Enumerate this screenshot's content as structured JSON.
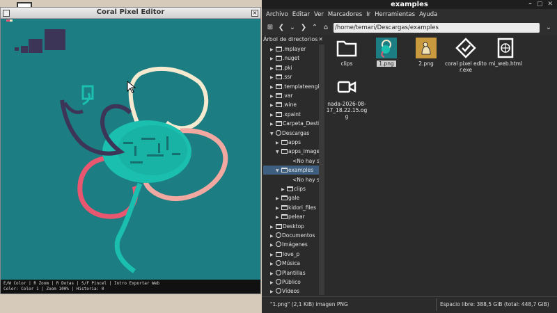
{
  "coral": {
    "title": "Coral Pixel Editor",
    "status_line1": "E/W Color | R Zoom | R Dotas | S/F Pincel | Intro Exportar Web",
    "status_line2": "Color: Color 1 | Zoom 100% | Historia: 0",
    "colors": {
      "background": "#1c7d83",
      "teal": "#1abfb0",
      "dark_purple": "#3d3557",
      "cream": "#f5ead0",
      "pink": "#f0a8a0",
      "red_pink": "#e8576f"
    }
  },
  "fm": {
    "title": "examples",
    "menu": [
      "Archivo",
      "Editar",
      "Ver",
      "Marcadores",
      "Ir",
      "Herramientas",
      "Ayuda"
    ],
    "path": "/home/temari/Descargas/examples",
    "sidebar_title": "Árbol de directorios",
    "tree": [
      {
        "label": ".mplayer",
        "indent": 1,
        "arrow": "▶",
        "icon": "folder"
      },
      {
        "label": ".nuget",
        "indent": 1,
        "arrow": "▶",
        "icon": "folder"
      },
      {
        "label": ".pki",
        "indent": 1,
        "arrow": "▶",
        "icon": "folder"
      },
      {
        "label": ".ssr",
        "indent": 1,
        "arrow": "▶",
        "icon": "folder"
      },
      {
        "label": ".templateengine",
        "indent": 1,
        "arrow": "▶",
        "icon": "folder"
      },
      {
        "label": ".var",
        "indent": 1,
        "arrow": "▶",
        "icon": "folder"
      },
      {
        "label": ".wine",
        "indent": 1,
        "arrow": "▶",
        "icon": "folder"
      },
      {
        "label": ".xpaint",
        "indent": 1,
        "arrow": "▶",
        "icon": "folder"
      },
      {
        "label": "Carpeta_Destino",
        "indent": 1,
        "arrow": "▶",
        "icon": "folder"
      },
      {
        "label": "Descargas",
        "indent": 1,
        "arrow": "▼",
        "icon": "download"
      },
      {
        "label": "apps",
        "indent": 2,
        "arrow": "▶",
        "icon": "folder"
      },
      {
        "label": "apps_imagenes",
        "indent": 2,
        "arrow": "▼",
        "icon": "folder"
      },
      {
        "label": "<No hay su",
        "indent": 4,
        "arrow": "",
        "icon": ""
      },
      {
        "label": "examples",
        "indent": 2,
        "arrow": "▼",
        "icon": "folder",
        "selected": true
      },
      {
        "label": "<No hay su",
        "indent": 4,
        "arrow": "",
        "icon": ""
      },
      {
        "label": "clips",
        "indent": 3,
        "arrow": "▶",
        "icon": "folder"
      },
      {
        "label": "gale",
        "indent": 2,
        "arrow": "▶",
        "icon": "folder"
      },
      {
        "label": "kidori_files",
        "indent": 2,
        "arrow": "▶",
        "icon": "folder"
      },
      {
        "label": "pelear",
        "indent": 2,
        "arrow": "▶",
        "icon": "folder"
      },
      {
        "label": "Desktop",
        "indent": 1,
        "arrow": "▶",
        "icon": "folder"
      },
      {
        "label": "Documentos",
        "indent": 1,
        "arrow": "▶",
        "icon": "document"
      },
      {
        "label": "Imágenes",
        "indent": 1,
        "arrow": "▶",
        "icon": "camera"
      },
      {
        "label": "love_p",
        "indent": 1,
        "arrow": "▶",
        "icon": "folder"
      },
      {
        "label": "Música",
        "indent": 1,
        "arrow": "▶",
        "icon": "music"
      },
      {
        "label": "Plantillas",
        "indent": 1,
        "arrow": "▶",
        "icon": "template"
      },
      {
        "label": "Público",
        "indent": 1,
        "arrow": "▶",
        "icon": "share"
      },
      {
        "label": "Vídeos",
        "indent": 1,
        "arrow": "▶",
        "icon": "video"
      }
    ],
    "files": [
      {
        "name": "clips",
        "type": "folder"
      },
      {
        "name": "1.png",
        "type": "png-teal",
        "selected": true
      },
      {
        "name": "2.png",
        "type": "png-gold"
      },
      {
        "name": "coral pixel editor.exe",
        "type": "exe"
      },
      {
        "name": "mi_web.html",
        "type": "html"
      },
      {
        "name": "nada-2026-08-17_18.22.15.ogg",
        "type": "video"
      }
    ],
    "status_left": "\"1.png\" (2,1 KiB) imagen PNG",
    "status_right": "Espacio libre: 388,5 GiB (total: 448,7 GiB)"
  }
}
